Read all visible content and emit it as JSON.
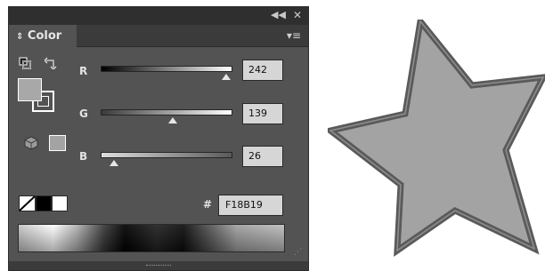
{
  "panel": {
    "title_bar": {
      "collapse_icon": "double-chevron-left-icon",
      "close_icon": "close-icon"
    },
    "tab_label": "Color",
    "menu_icon": "panel-menu-icon",
    "fill_color": "#a8a8a8",
    "stroke_color": "#535353",
    "sliders": [
      {
        "label": "R",
        "value": "242",
        "fraction": 0.949,
        "gradient_from": "#000000",
        "gradient_to": "#ffffff"
      },
      {
        "label": "G",
        "value": "139",
        "fraction": 0.545,
        "gradient_from": "#3a3a3a",
        "gradient_to": "#ffffff"
      },
      {
        "label": "B",
        "value": "26",
        "fraction": 0.102,
        "gradient_from": "#dddddd",
        "gradient_to": "#5a5a5a"
      }
    ],
    "hex_label": "#",
    "hex_value": "F18B19",
    "swatches": {
      "none": "none-swatch",
      "black": "#000000",
      "white": "#ffffff"
    },
    "gamut_warning_icon": "cube-icon",
    "gamut_color": "#a3a3a3"
  },
  "canvas": {
    "star_fill": "#a3a3a3",
    "star_stroke": "#5a5a5a"
  }
}
